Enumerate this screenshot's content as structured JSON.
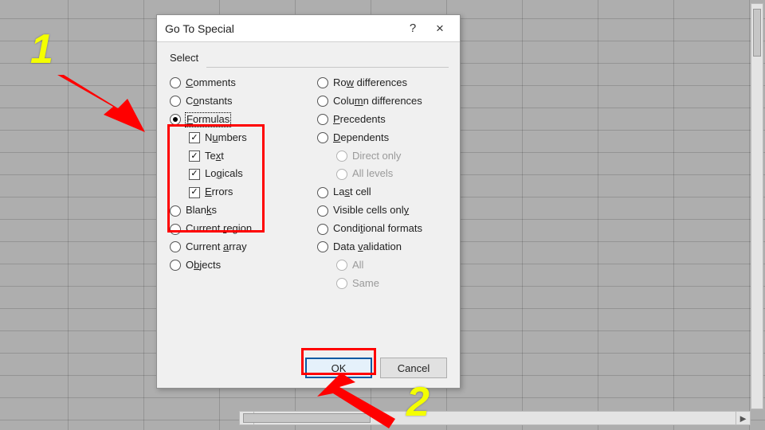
{
  "dialog": {
    "title": "Go To Special",
    "help_symbol": "?",
    "close_symbol": "×",
    "section_label": "Select",
    "left_options": {
      "comments": {
        "label_pre": "",
        "mnemonic": "C",
        "label_post": "omments",
        "checked": false
      },
      "constants": {
        "label_pre": "C",
        "mnemonic": "o",
        "label_post": "nstants",
        "checked": false
      },
      "formulas": {
        "label_pre": "",
        "mnemonic": "F",
        "label_post": "ormulas",
        "checked": true,
        "focused": true
      },
      "formulas_sub": {
        "numbers": {
          "label_pre": "N",
          "mnemonic": "u",
          "label_post": "mbers",
          "checked": true
        },
        "text": {
          "label_pre": "Te",
          "mnemonic": "x",
          "label_post": "t",
          "checked": true
        },
        "logicals": {
          "label_pre": "Lo",
          "mnemonic": "g",
          "label_post": "icals",
          "checked": true
        },
        "errors": {
          "label_pre": "",
          "mnemonic": "E",
          "label_post": "rrors",
          "checked": true
        }
      },
      "blanks": {
        "label_pre": "Blan",
        "mnemonic": "k",
        "label_post": "s",
        "checked": false
      },
      "current_region": {
        "label_pre": "Current ",
        "mnemonic": "r",
        "label_post": "egion",
        "checked": false
      },
      "current_array": {
        "label_pre": "Current ",
        "mnemonic": "a",
        "label_post": "rray",
        "checked": false
      },
      "objects": {
        "label_pre": "O",
        "mnemonic": "b",
        "label_post": "jects",
        "checked": false
      }
    },
    "right_options": {
      "row_diff": {
        "label_pre": "Ro",
        "mnemonic": "w",
        "label_post": " differences",
        "checked": false
      },
      "col_diff": {
        "label_pre": "Colu",
        "mnemonic": "m",
        "label_post": "n differences",
        "checked": false
      },
      "precedents": {
        "label_pre": "",
        "mnemonic": "P",
        "label_post": "recedents",
        "checked": false
      },
      "dependents": {
        "label_pre": "",
        "mnemonic": "D",
        "label_post": "ependents",
        "checked": false
      },
      "direct_only": {
        "label": "Direct only",
        "checked": false,
        "disabled": true
      },
      "all_levels": {
        "label": "All levels",
        "checked": false,
        "disabled": true
      },
      "last_cell": {
        "label_pre": "La",
        "mnemonic": "s",
        "label_post": "t cell",
        "checked": false
      },
      "visible": {
        "label_pre": "Visible cells onl",
        "mnemonic": "y",
        "label_post": "",
        "checked": false
      },
      "cond_fmt": {
        "label_pre": "Condi",
        "mnemonic": "t",
        "label_post": "ional formats",
        "checked": false
      },
      "data_val": {
        "label_pre": "Data ",
        "mnemonic": "v",
        "label_post": "alidation",
        "checked": false
      },
      "dv_all": {
        "label": "All",
        "checked": false,
        "disabled": true
      },
      "dv_same": {
        "label": "Same",
        "checked": false,
        "disabled": true
      }
    },
    "buttons": {
      "ok": "OK",
      "cancel": "Cancel"
    }
  },
  "annotations": {
    "step1": "1",
    "step2": "2"
  }
}
